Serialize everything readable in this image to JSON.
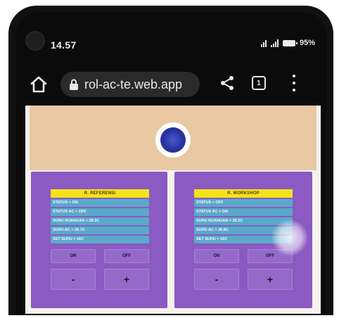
{
  "status_bar": {
    "time": "14.57",
    "battery": "95%"
  },
  "browser": {
    "url": "rol-ac-te.web.app",
    "home_icon": "home-icon",
    "lock_icon": "lock-icon",
    "share_icon": "share-icon",
    "tabs_icon": "tabs-icon",
    "menu_icon": "more-vert-icon",
    "tab_count": "1"
  },
  "page": {
    "logo": "institution-logo",
    "cards": [
      {
        "title": "R. REFERENSI",
        "rows": [
          "STATUS = ON",
          "STATUS AC = OFF",
          "SUHU RUANGAN = 28.3C",
          "SUHU AC = 26.7C",
          "SET SUHU = 16C"
        ],
        "on_label": "ON",
        "off_label": "OFF",
        "minus_label": "-",
        "plus_label": "+"
      },
      {
        "title": "R. WORKSHOP",
        "rows": [
          "STATUS = OFF",
          "STATUS AC = ON",
          "SUHU RUANGAN = 28.3C",
          "SUHU AC = 26.8C",
          "SET SUHU = 16C"
        ],
        "on_label": "ON",
        "off_label": "OFF",
        "minus_label": "-",
        "plus_label": "+"
      }
    ]
  },
  "colors": {
    "header_band": "#e8c9a4",
    "card_bg": "#8b5ac2",
    "title_bg": "#f6e21a",
    "row_bg": "#5aa9c9"
  }
}
